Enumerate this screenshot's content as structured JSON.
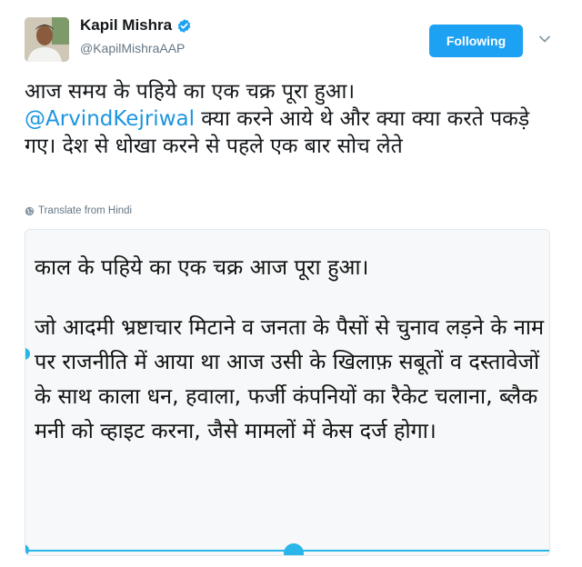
{
  "user": {
    "display_name": "Kapil Mishra",
    "handle": "@KapilMishraAAP",
    "verified": true
  },
  "follow_button": {
    "label": "Following"
  },
  "tweet": {
    "line1": "आज समय के पहिये का एक चक्र पूरा हुआ।",
    "mention": "@ArvindKejriwal",
    "after_mention": " क्या करने आये थे और क्या क्या करते पकड़े गए। देश से धोखा करने से पहले एक बार सोच लेते"
  },
  "translate": {
    "label": "Translate from Hindi"
  },
  "media": {
    "line1": "काल के पहिये का एक चक्र आज पूरा हुआ।",
    "paragraph": "जो आदमी भ्रष्टाचार मिटाने व जनता के पैसों से चुनाव लड़ने के नाम पर राजनीति में आया था आज उसी के खिलाफ़ सबूतों व दस्तावेजों के साथ काला धन, हवाला, फर्जी कंपनियों का रैकेट चलाना, ब्लैक मनी को व्हाइट करना, जैसे मामलों में केस दर्ज होगा।"
  },
  "colors": {
    "follow_bg": "#1da1f2",
    "mention": "#1b95e0",
    "handle": "#657786",
    "selection_handle": "#29b6e8"
  },
  "icons": [
    "verified-icon",
    "chevron-down-icon",
    "globe-icon"
  ]
}
